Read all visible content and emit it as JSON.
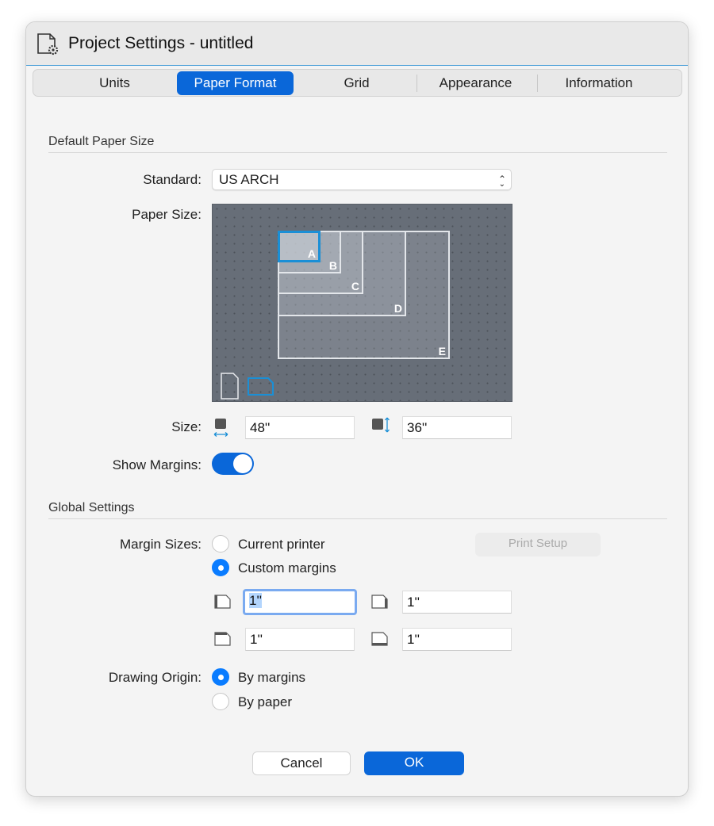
{
  "window": {
    "title": "Project Settings - untitled",
    "title_icon": "document-gear-icon"
  },
  "tabs": [
    {
      "label": "Units"
    },
    {
      "label": "Paper Format",
      "active": true
    },
    {
      "label": "Grid"
    },
    {
      "label": "Appearance"
    },
    {
      "label": "Information"
    }
  ],
  "default_paper": {
    "section": "Default Paper Size",
    "standard_label": "Standard:",
    "standard_value": "US ARCH",
    "paper_size_label": "Paper Size:",
    "sizes": [
      "A",
      "B",
      "C",
      "D",
      "E"
    ],
    "selected_size": "A",
    "orientation": "landscape",
    "size_label": "Size:",
    "width": "48''",
    "height": "36''",
    "show_margins_label": "Show Margins:",
    "show_margins": true
  },
  "global": {
    "section": "Global Settings",
    "margin_sizes_label": "Margin Sizes:",
    "margin_options": [
      "Current printer",
      "Custom margins"
    ],
    "margin_selected": "Custom margins",
    "print_setup": "Print Setup",
    "margins": {
      "left": "1''",
      "right": "1''",
      "top": "1''",
      "bottom": "1''"
    },
    "drawing_origin_label": "Drawing Origin:",
    "origin_options": [
      "By margins",
      "By paper"
    ],
    "origin_selected": "By margins"
  },
  "buttons": {
    "cancel": "Cancel",
    "ok": "OK"
  },
  "colors": {
    "accent": "#0a67d9"
  }
}
